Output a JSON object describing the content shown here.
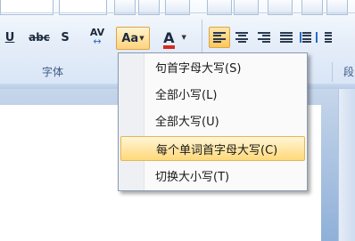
{
  "ribbon": {
    "format_buttons": {
      "underline": "U",
      "strikethrough": "abc",
      "shadow": "S",
      "char_spacing": "AV",
      "change_case": "Aa",
      "font_color": "A"
    },
    "group_labels": {
      "font": "字体",
      "paragraph": "段"
    },
    "accent_color": "#ffc75a",
    "font_color_swatch": "#d52b1e"
  },
  "change_case_menu": {
    "items": [
      {
        "label": "句首字母大写(S)",
        "highlighted": false
      },
      {
        "label": "全部小写(L)",
        "highlighted": false
      },
      {
        "label": "全部大写(U)",
        "highlighted": false
      },
      {
        "label": "每个单词首字母大写(C)",
        "highlighted": true
      },
      {
        "label": "切换大小写(T)",
        "highlighted": false
      }
    ]
  }
}
